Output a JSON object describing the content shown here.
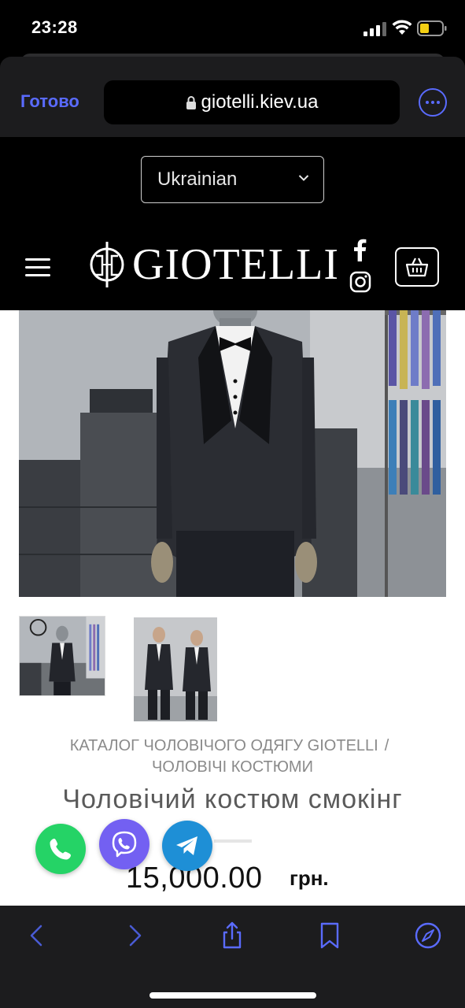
{
  "status_bar": {
    "time": "23:28"
  },
  "browser": {
    "done_label": "Готово",
    "url": "giotelli.kiev.ua",
    "accent_color": "#5a6bff"
  },
  "header": {
    "language": "Ukrainian",
    "brand": "GIOTELLI",
    "icons": [
      "menu-icon",
      "facebook-icon",
      "instagram-icon",
      "cart-icon"
    ]
  },
  "product": {
    "breadcrumb": [
      "КАТАЛОГ ЧОЛОВІЧОГО ОДЯГУ GIOTELLI",
      "/",
      "ЧОЛОВІЧІ КОСТЮМИ"
    ],
    "title": "Чоловічий костюм смокінг",
    "price": "15,000.00",
    "currency": "грн."
  },
  "contacts": {
    "icons": [
      "phone-icon",
      "viber-icon",
      "telegram-icon"
    ],
    "colors": {
      "phone": "#25d366",
      "viber": "#7360f2",
      "telegram": "#1e8fd6"
    }
  },
  "toolbar": {
    "icons": [
      "back-icon",
      "forward-icon",
      "share-icon",
      "bookmarks-icon",
      "compass-icon"
    ]
  }
}
